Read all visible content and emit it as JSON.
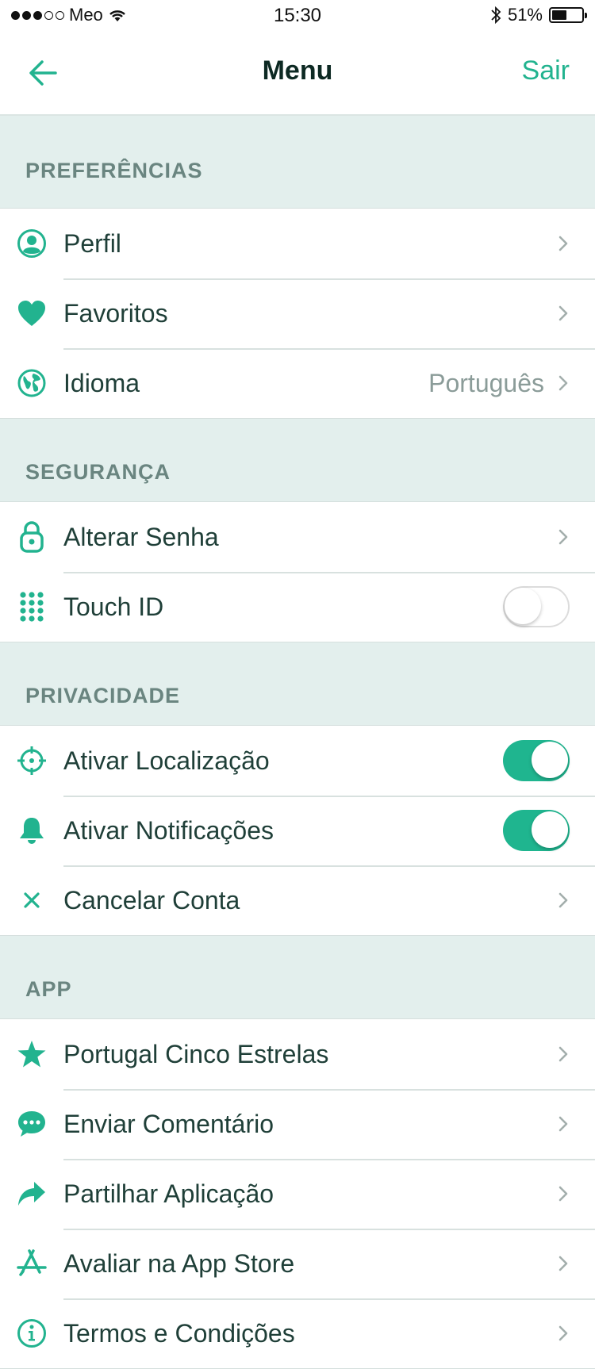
{
  "status_bar": {
    "carrier": "Meo",
    "time": "15:30",
    "battery": "51%",
    "battery_level": 0.51
  },
  "nav": {
    "title": "Menu",
    "right_action": "Sair"
  },
  "colors": {
    "accent": "#22b38f",
    "section_bg": "#e3efed",
    "section_text": "#6a8580",
    "toggle_on": "#1fb58f"
  },
  "sections": [
    {
      "title": "PREFERÊNCIAS",
      "items": [
        {
          "label": "Perfil",
          "icon": "profile-icon"
        },
        {
          "label": "Favoritos",
          "icon": "heart-icon"
        },
        {
          "label": "Idioma",
          "icon": "globe-icon",
          "value": "Português"
        }
      ]
    },
    {
      "title": "SEGURANÇA",
      "items": [
        {
          "label": "Alterar Senha",
          "icon": "lock-icon"
        },
        {
          "label": "Touch ID",
          "icon": "keypad-icon",
          "toggle": false
        }
      ]
    },
    {
      "title": "PRIVACIDADE",
      "items": [
        {
          "label": "Ativar Localização",
          "icon": "crosshair-icon",
          "toggle": true
        },
        {
          "label": "Ativar Notificações",
          "icon": "bell-icon",
          "toggle": true
        },
        {
          "label": "Cancelar Conta",
          "icon": "close-icon"
        }
      ]
    },
    {
      "title": "APP",
      "items": [
        {
          "label": "Portugal Cinco Estrelas",
          "icon": "star-icon"
        },
        {
          "label": "Enviar Comentário",
          "icon": "chat-icon"
        },
        {
          "label": "Partilhar Aplicação",
          "icon": "share-icon"
        },
        {
          "label": "Avaliar na App Store",
          "icon": "app-store-icon"
        },
        {
          "label": "Termos e Condições",
          "icon": "info-icon"
        }
      ]
    }
  ]
}
